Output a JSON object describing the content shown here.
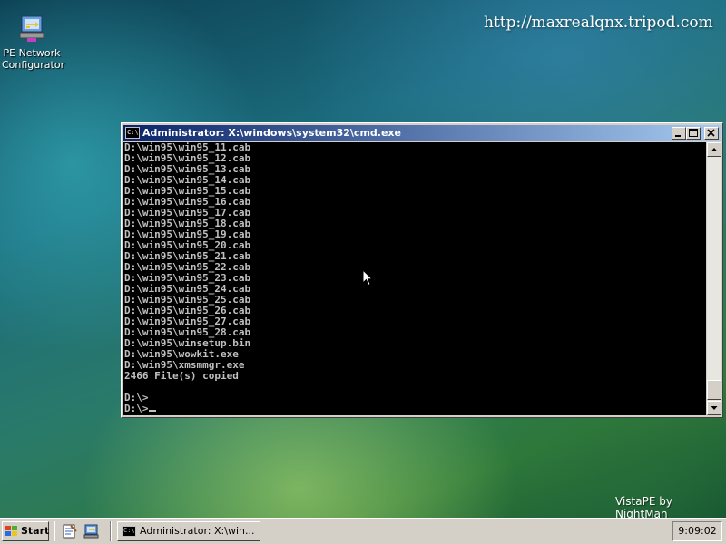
{
  "desktop": {
    "icons": [
      {
        "label_line1": "PE Network",
        "label_line2": "Configurator"
      }
    ],
    "watermark_url": "http://maxrealqnx.tripod.com",
    "brand_text": "VistaPE by NightMan"
  },
  "cmd_window": {
    "title": "Administrator: X:\\windows\\system32\\cmd.exe",
    "icon_text": "C:\\",
    "lines": [
      "D:\\win95\\win95_11.cab",
      "D:\\win95\\win95_12.cab",
      "D:\\win95\\win95_13.cab",
      "D:\\win95\\win95_14.cab",
      "D:\\win95\\win95_15.cab",
      "D:\\win95\\win95_16.cab",
      "D:\\win95\\win95_17.cab",
      "D:\\win95\\win95_18.cab",
      "D:\\win95\\win95_19.cab",
      "D:\\win95\\win95_20.cab",
      "D:\\win95\\win95_21.cab",
      "D:\\win95\\win95_22.cab",
      "D:\\win95\\win95_23.cab",
      "D:\\win95\\win95_24.cab",
      "D:\\win95\\win95_25.cab",
      "D:\\win95\\win95_26.cab",
      "D:\\win95\\win95_27.cab",
      "D:\\win95\\win95_28.cab",
      "D:\\win95\\winsetup.bin",
      "D:\\win95\\wowkit.exe",
      "D:\\win95\\xmsmmgr.exe",
      "2466 File(s) copied",
      "",
      "D:\\>"
    ],
    "prompt": "D:\\>",
    "buttons": {
      "minimize": "minimize",
      "maximize": "maximize",
      "close": "close"
    }
  },
  "taskbar": {
    "start_label": "Start",
    "quick_launch": [
      "notepad-icon",
      "network-icon"
    ],
    "task_button_label": "Administrator: X:\\win...",
    "task_icon_text": "C:\\",
    "clock": "9:09:02"
  },
  "colors": {
    "titlebar_start": "#0a246a",
    "titlebar_end": "#a6caf0",
    "console_bg": "#000000",
    "console_fg": "#c0c0c0",
    "chrome": "#d4d0c8"
  }
}
